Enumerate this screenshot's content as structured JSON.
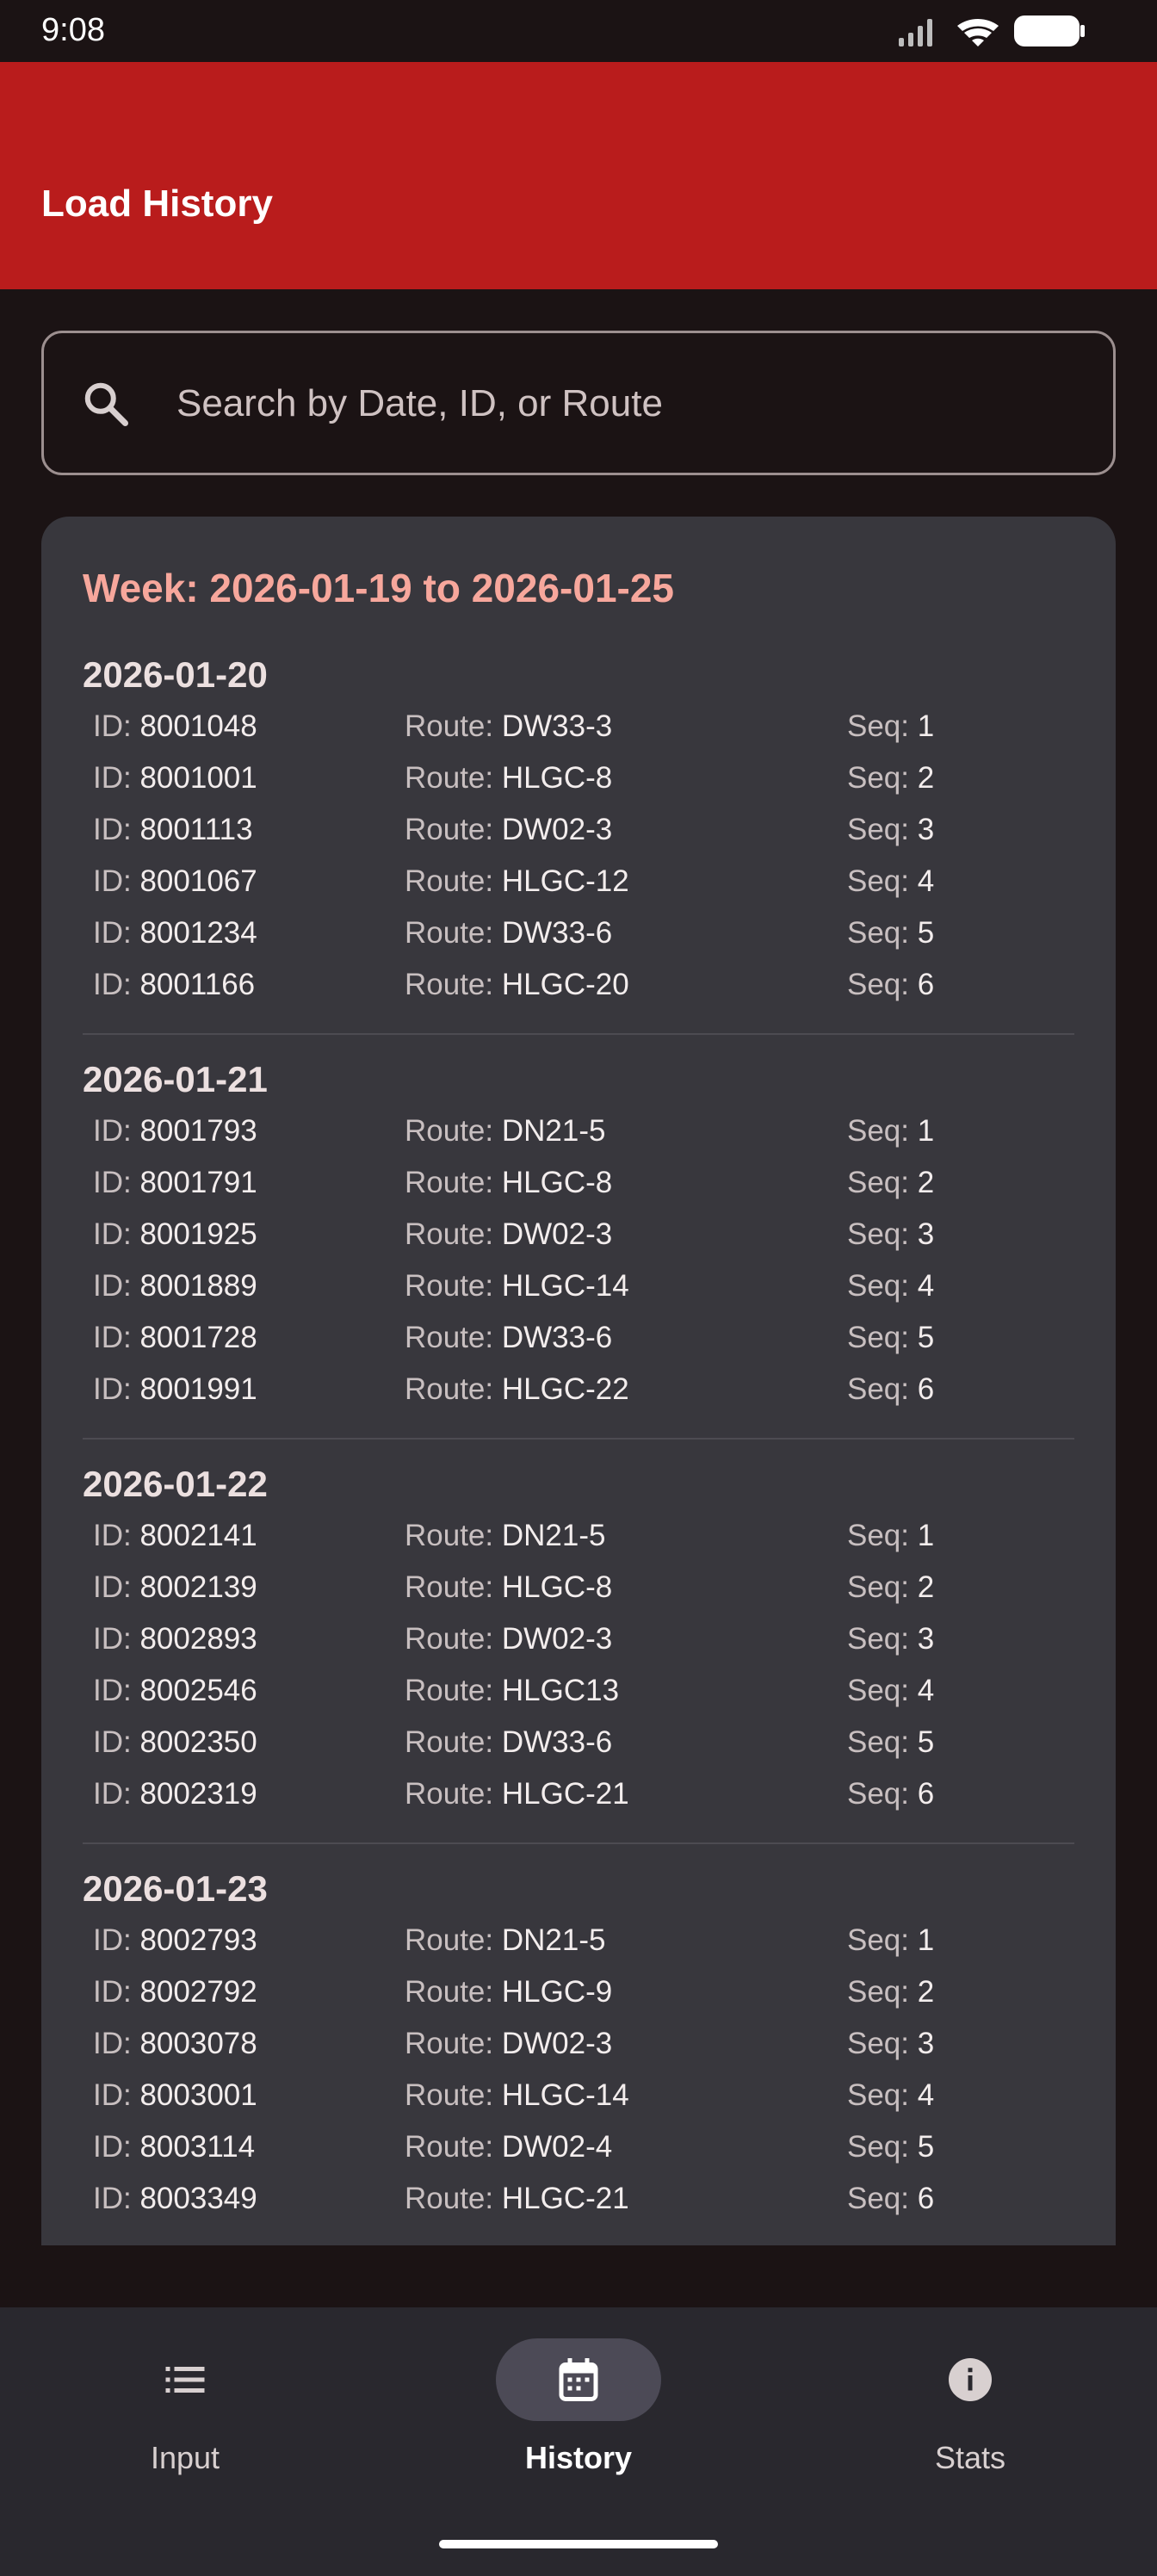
{
  "status_bar": {
    "time": "9:08"
  },
  "app_bar": {
    "title": "Load History"
  },
  "search": {
    "placeholder": "Search by Date, ID, or Route",
    "value": ""
  },
  "history": {
    "week_title": "Week: 2026-01-19 to 2026-01-25",
    "labels": {
      "id": "ID:",
      "route": "Route:",
      "seq": "Seq:"
    },
    "days": [
      {
        "date": "2026-01-20",
        "loads": [
          {
            "id": "8001048",
            "route": "DW33-3",
            "seq": "1"
          },
          {
            "id": "8001001",
            "route": "HLGC-8",
            "seq": "2"
          },
          {
            "id": "8001113",
            "route": "DW02-3",
            "seq": "3"
          },
          {
            "id": "8001067",
            "route": "HLGC-12",
            "seq": "4"
          },
          {
            "id": "8001234",
            "route": "DW33-6",
            "seq": "5"
          },
          {
            "id": "8001166",
            "route": "HLGC-20",
            "seq": "6"
          }
        ]
      },
      {
        "date": "2026-01-21",
        "loads": [
          {
            "id": "8001793",
            "route": "DN21-5",
            "seq": "1"
          },
          {
            "id": "8001791",
            "route": "HLGC-8",
            "seq": "2"
          },
          {
            "id": "8001925",
            "route": "DW02-3",
            "seq": "3"
          },
          {
            "id": "8001889",
            "route": "HLGC-14",
            "seq": "4"
          },
          {
            "id": "8001728",
            "route": "DW33-6",
            "seq": "5"
          },
          {
            "id": "8001991",
            "route": "HLGC-22",
            "seq": "6"
          }
        ]
      },
      {
        "date": "2026-01-22",
        "loads": [
          {
            "id": "8002141",
            "route": "DN21-5",
            "seq": "1"
          },
          {
            "id": "8002139",
            "route": "HLGC-8",
            "seq": "2"
          },
          {
            "id": "8002893",
            "route": "DW02-3",
            "seq": "3"
          },
          {
            "id": "8002546",
            "route": "HLGC13",
            "seq": "4"
          },
          {
            "id": "8002350",
            "route": "DW33-6",
            "seq": "5"
          },
          {
            "id": "8002319",
            "route": "HLGC-21",
            "seq": "6"
          }
        ]
      },
      {
        "date": "2026-01-23",
        "loads": [
          {
            "id": "8002793",
            "route": "DN21-5",
            "seq": "1"
          },
          {
            "id": "8002792",
            "route": "HLGC-9",
            "seq": "2"
          },
          {
            "id": "8003078",
            "route": "DW02-3",
            "seq": "3"
          },
          {
            "id": "8003001",
            "route": "HLGC-14",
            "seq": "4"
          },
          {
            "id": "8003114",
            "route": "DW02-4",
            "seq": "5"
          },
          {
            "id": "8003349",
            "route": "HLGC-21",
            "seq": "6"
          }
        ]
      }
    ]
  },
  "nav": {
    "items": [
      {
        "label": "Input",
        "icon": "list-icon",
        "active": false
      },
      {
        "label": "History",
        "icon": "calendar-icon",
        "active": true
      },
      {
        "label": "Stats",
        "icon": "info-icon",
        "active": false
      }
    ]
  },
  "colors": {
    "app_bar": "#b91c1c",
    "background": "#1b1314",
    "card": "#38373d",
    "week_title": "#f7a79c",
    "nav_bar": "#29282e",
    "nav_active_pill": "#4c4a56"
  }
}
